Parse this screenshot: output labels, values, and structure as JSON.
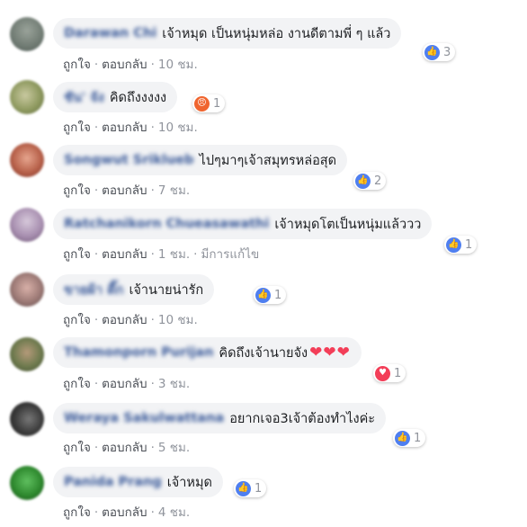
{
  "comments": [
    {
      "author": "Darawan Chi",
      "text": "เจ้าหมุด เป็นหนุ่มหล่อ งานดีตามพี่ ๆ แล้ว",
      "emoji": "",
      "like": "ถูกใจ",
      "reply": "ตอบกลับ",
      "time": "10 ชม.",
      "edited": "",
      "reaction": "like",
      "reaction_icon": "like-icon",
      "count": "3"
    },
    {
      "author": "ชัน' จัง",
      "text": "คิดถึงงงงง",
      "emoji": "",
      "like": "ถูกใจ",
      "reply": "ตอบกลับ",
      "time": "10 ชม.",
      "edited": "",
      "reaction": "angry",
      "reaction_icon": "angry-face-icon",
      "count": "1"
    },
    {
      "author": "Songwut Sriklueb",
      "text": "ไปๆมาๆเจ้าสมุทรหล่อสุด",
      "emoji": "",
      "like": "ถูกใจ",
      "reply": "ตอบกลับ",
      "time": "7 ชม.",
      "edited": "",
      "reaction": "like",
      "reaction_icon": "like-icon",
      "count": "2"
    },
    {
      "author": "Ratchanikorn Chueasawathi",
      "text": "เจ้าหมุดโตเป็นหนุ่มแล้ววว",
      "emoji": "",
      "like": "ถูกใจ",
      "reply": "ตอบกลับ",
      "time": "1 ชม.",
      "edited": "มีการแก้ไข",
      "reaction": "like",
      "reaction_icon": "like-icon",
      "count": "1"
    },
    {
      "author": "ขายผ้า ดี๊ก",
      "text": "เจ้านายน่ารัก",
      "emoji": "",
      "like": "ถูกใจ",
      "reply": "ตอบกลับ",
      "time": "10 ชม.",
      "edited": "",
      "reaction": "like",
      "reaction_icon": "like-icon",
      "count": "1"
    },
    {
      "author": "Thamonporn Purijan",
      "text": "คิดถึงเจ้านายจัง",
      "emoji": "❤❤❤",
      "like": "ถูกใจ",
      "reply": "ตอบกลับ",
      "time": "3 ชม.",
      "edited": "",
      "reaction": "love",
      "reaction_icon": "love-icon",
      "count": "1"
    },
    {
      "author": "Weraya Sakulwattana",
      "text": "อยากเจอ3เจ้าต้องทำไงค่ะ",
      "emoji": "",
      "like": "ถูกใจ",
      "reply": "ตอบกลับ",
      "time": "5 ชม.",
      "edited": "",
      "reaction": "like",
      "reaction_icon": "like-icon",
      "count": "1"
    },
    {
      "author": "Panida Prang",
      "text": "เจ้าหมุด",
      "emoji": "",
      "like": "ถูกใจ",
      "reply": "ตอบกลับ",
      "time": "4 ชม.",
      "edited": "",
      "reaction": "like",
      "reaction_icon": "like-icon",
      "count": "1"
    }
  ],
  "colors": {
    "author": "#385898",
    "bubble": "#f2f3f5",
    "meta": "#90949c",
    "like": "#4f7ff0",
    "love": "#f33e58",
    "angry": "#f0652f"
  }
}
